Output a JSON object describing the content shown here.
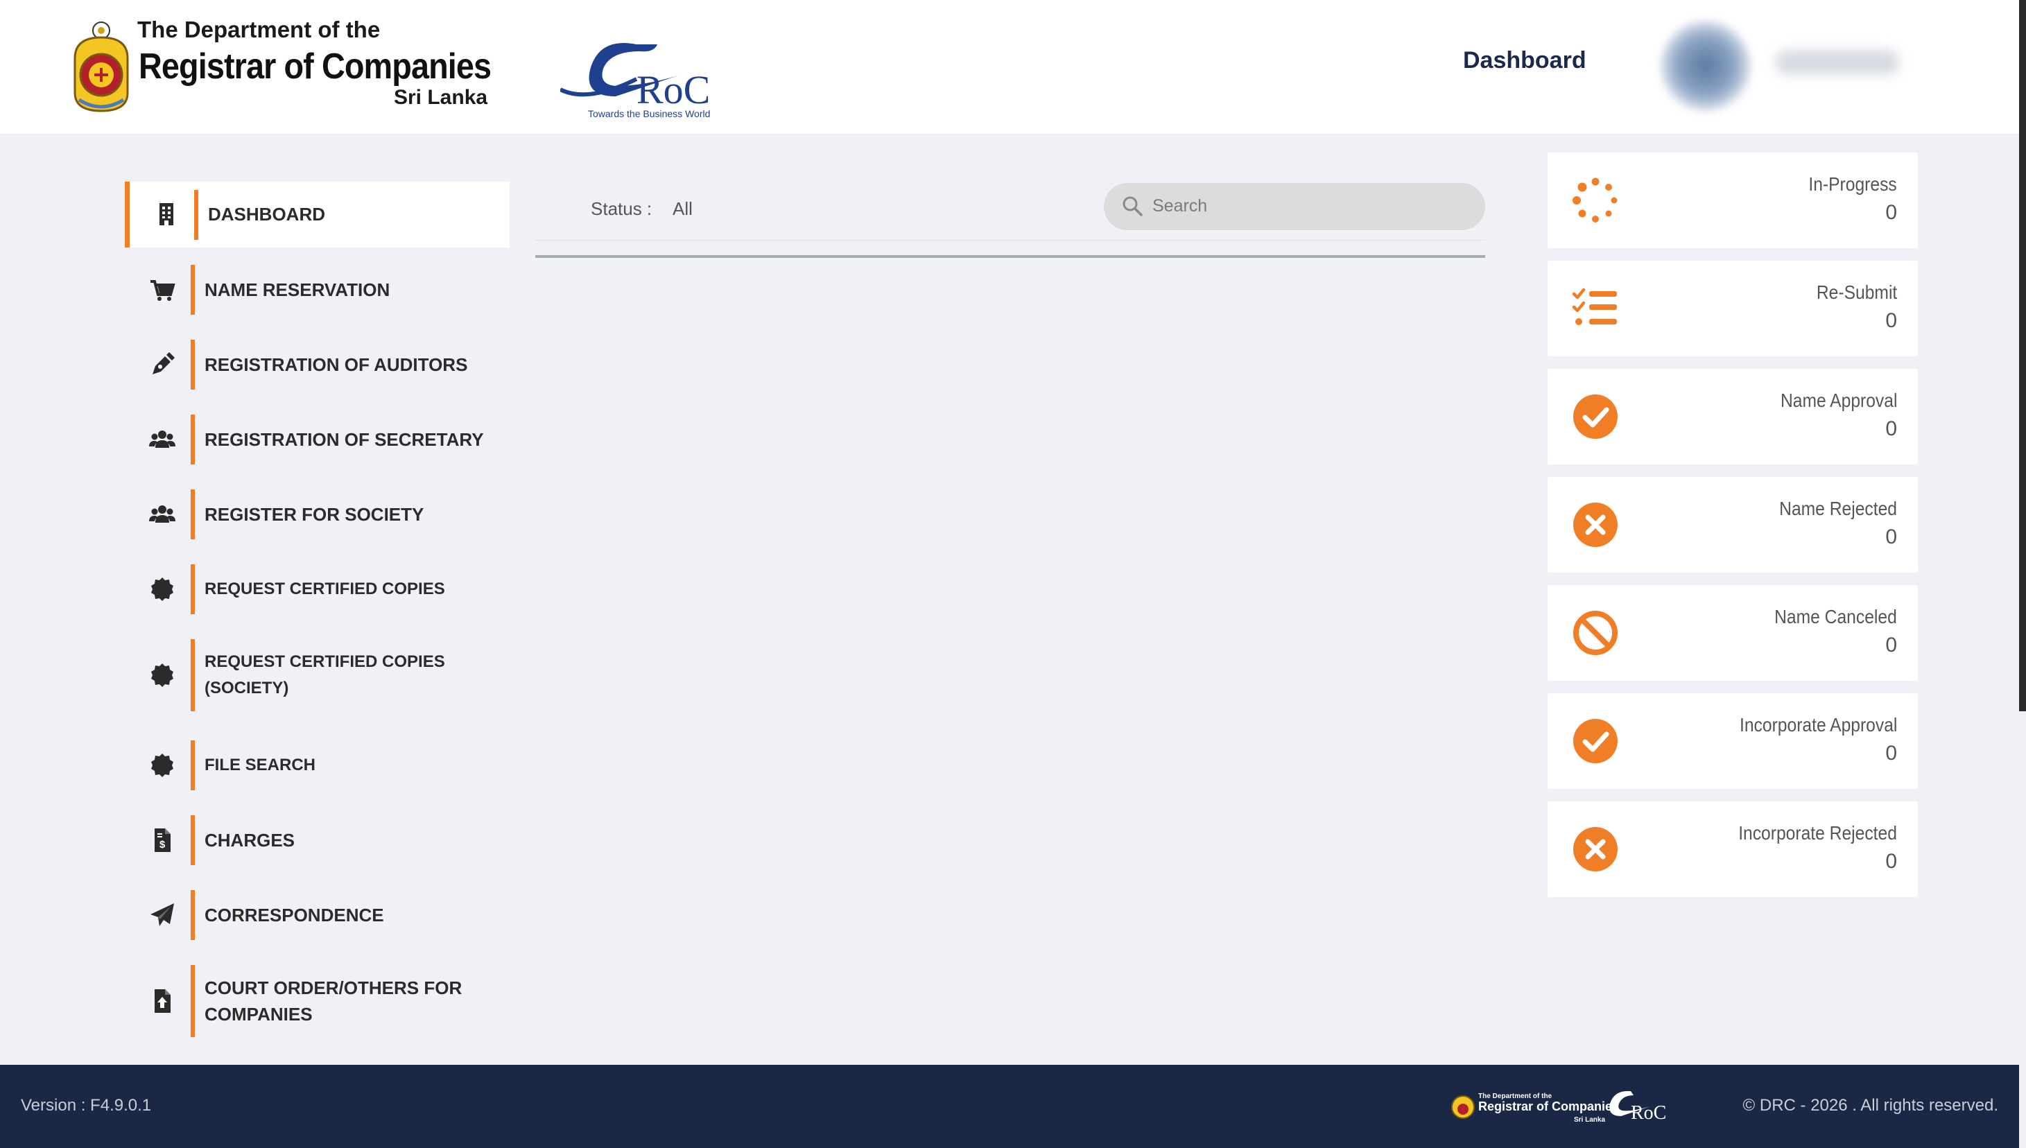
{
  "header": {
    "dept_line1": "The Department of the",
    "dept_line2": "Registrar of Companies",
    "dept_line3": "Sri Lanka",
    "eroc_mark": "RoC",
    "eroc_tagline": "Towards the Business World",
    "nav_dashboard": "Dashboard"
  },
  "sidebar": {
    "items": [
      {
        "label": "DASHBOARD",
        "icon": "building-icon"
      },
      {
        "label": "NAME RESERVATION",
        "icon": "cart-icon"
      },
      {
        "label": "REGISTRATION OF AUDITORS",
        "icon": "pen-icon"
      },
      {
        "label": "REGISTRATION OF SECRETARY",
        "icon": "users-icon"
      },
      {
        "label": "REGISTER FOR SOCIETY",
        "icon": "users-icon"
      },
      {
        "label": "REQUEST CERTIFIED COPIES",
        "icon": "seal-icon"
      },
      {
        "label": "REQUEST CERTIFIED COPIES (SOCIETY)",
        "icon": "seal-icon"
      },
      {
        "label": "FILE SEARCH",
        "icon": "seal-icon"
      },
      {
        "label": "CHARGES",
        "icon": "invoice-icon"
      },
      {
        "label": "CORRESPONDENCE",
        "icon": "paper-plane-icon"
      },
      {
        "label": "COURT ORDER/OTHERS FOR COMPANIES",
        "icon": "file-upload-icon"
      }
    ]
  },
  "main": {
    "status_label": "Status :",
    "status_value": "All",
    "search_placeholder": "Search"
  },
  "stats": [
    {
      "label": "In-Progress",
      "count": "0",
      "icon": "spinner-icon"
    },
    {
      "label": "Re-Submit",
      "count": "0",
      "icon": "checklist-icon"
    },
    {
      "label": "Name Approval",
      "count": "0",
      "icon": "check-circle-icon"
    },
    {
      "label": "Name Rejected",
      "count": "0",
      "icon": "x-circle-icon"
    },
    {
      "label": "Name Canceled",
      "count": "0",
      "icon": "ban-icon"
    },
    {
      "label": "Incorporate Approval",
      "count": "0",
      "icon": "check-circle-icon"
    },
    {
      "label": "Incorporate Rejected",
      "count": "0",
      "icon": "x-circle-icon"
    }
  ],
  "footer": {
    "version": "Version : F4.9.0.1",
    "copyright": "© DRC - 2026 . All rights reserved."
  },
  "colors": {
    "accent": "#f07e26",
    "navy": "#1b2845",
    "background": "#eff1f6"
  }
}
